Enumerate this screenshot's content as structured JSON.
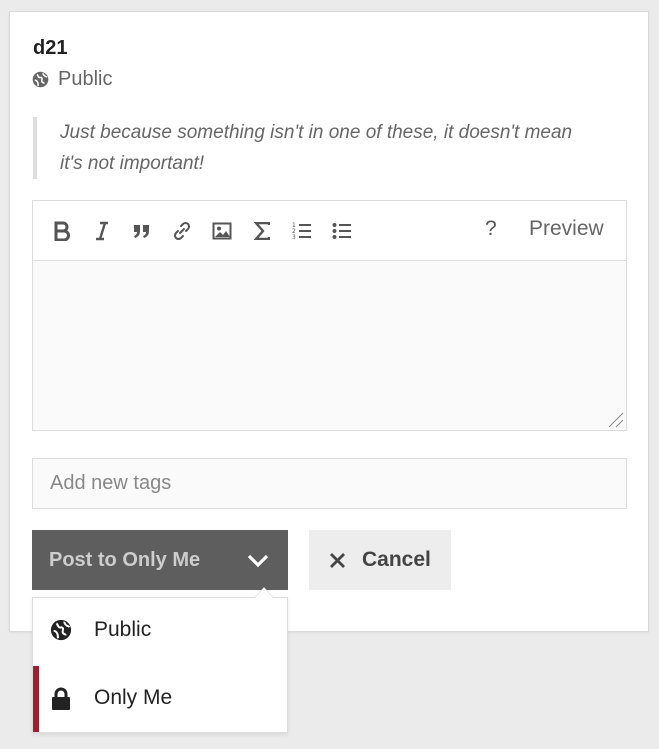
{
  "post": {
    "username": "d21",
    "visibility": "Public",
    "quote": "Just because something isn't in one of these, it doesn't mean it's not important!"
  },
  "editor": {
    "toolbar": {
      "bold_icon": "bold-icon",
      "italic_icon": "italic-icon",
      "quote_icon": "blockquote-icon",
      "link_icon": "link-icon",
      "image_icon": "image-icon",
      "math_icon": "sigma-icon",
      "ordered_list_icon": "ordered-list-icon",
      "bullet_list_icon": "bullet-list-icon",
      "help_label": "?",
      "preview_label": "Preview"
    },
    "body_value": ""
  },
  "tags": {
    "placeholder": "Add new tags",
    "value": ""
  },
  "actions": {
    "post_label": "Post to Only Me",
    "cancel_label": "Cancel"
  },
  "visibility_menu": {
    "options": [
      {
        "label": "Public",
        "icon": "globe-icon",
        "selected": false
      },
      {
        "label": "Only Me",
        "icon": "lock-icon",
        "selected": true
      }
    ]
  },
  "colors": {
    "selected_accent": "#9b1f2e",
    "post_button_bg": "#5e5e5e",
    "cancel_button_bg": "#ededed"
  }
}
